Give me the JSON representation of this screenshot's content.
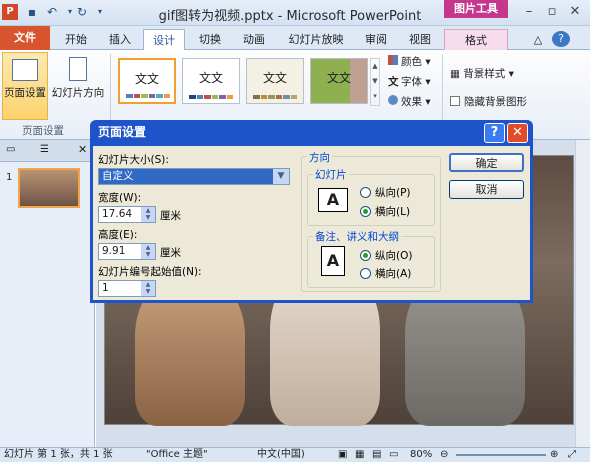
{
  "window": {
    "title": "gif图转为视频.pptx - Microsoft PowerPoint",
    "context_tab": "图片工具"
  },
  "tabs": [
    "文件",
    "开始",
    "插入",
    "设计",
    "切换",
    "动画",
    "幻灯片放映",
    "审阅",
    "视图",
    "格式"
  ],
  "ribbon": {
    "page_setup": "页面设置",
    "orientation": "幻灯片方向",
    "group_label": "页面设置",
    "theme_label": "文文",
    "colors": "颜色",
    "fonts": "字体",
    "effects": "效果",
    "bg_styles": "背景样式",
    "hide_bg": "隐藏背景图形"
  },
  "leftpane": {
    "slide_number": "1"
  },
  "status": {
    "slide_info": "幻灯片 第 1 张，共 1 张",
    "theme": "\"Office 主题\"",
    "language": "中文(中国)",
    "zoom": "80%"
  },
  "dialog": {
    "title": "页面设置",
    "size_label": "幻灯片大小(S):",
    "size_value": "自定义",
    "width_label": "宽度(W):",
    "width_value": "17.64",
    "height_label": "高度(E):",
    "height_value": "9.91",
    "unit": "厘米",
    "start_label": "幻灯片编号起始值(N):",
    "start_value": "1",
    "orientation_title": "方向",
    "slide_group": "幻灯片",
    "portrait": "纵向(P)",
    "landscape": "横向(L)",
    "notes_group": "备注、讲义和大纲",
    "notes_portrait": "纵向(O)",
    "notes_landscape": "横向(A)",
    "ok": "确定",
    "cancel": "取消"
  }
}
